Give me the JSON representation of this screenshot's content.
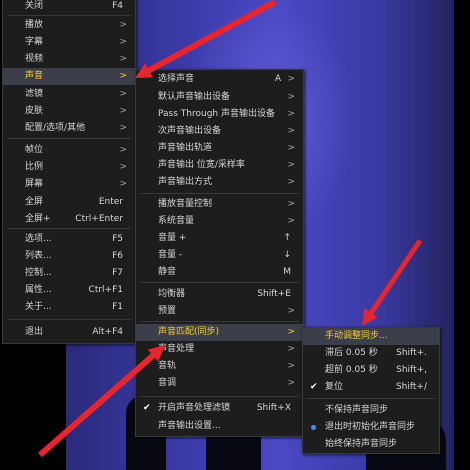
{
  "colors": {
    "highlight_text": "#ffcc33",
    "annotation_arrow": "#e8242c",
    "radio_dot": "#4a90e2"
  },
  "main_menu": {
    "items": [
      {
        "label": "关闭",
        "shortcut": "F4"
      },
      {
        "label": "播放",
        "arrow": ">"
      },
      {
        "label": "字幕",
        "arrow": ">"
      },
      {
        "label": "视频",
        "arrow": ">"
      },
      {
        "label": "声音",
        "arrow": ">"
      },
      {
        "label": "滤镜",
        "arrow": ">"
      },
      {
        "label": "皮肤",
        "arrow": ">"
      },
      {
        "label": "配置/选项/其他",
        "arrow": ">"
      },
      {
        "label": "帧位",
        "arrow": ">"
      },
      {
        "label": "比例",
        "arrow": ">"
      },
      {
        "label": "屏幕",
        "arrow": ">"
      },
      {
        "label": "全屏",
        "shortcut": "Enter"
      },
      {
        "label": "全屏+",
        "shortcut": "Ctrl+Enter"
      },
      {
        "label": "选项...",
        "shortcut": "F5"
      },
      {
        "label": "列表...",
        "shortcut": "F6"
      },
      {
        "label": "控制...",
        "shortcut": "F7"
      },
      {
        "label": "属性...",
        "shortcut": "Ctrl+F1"
      },
      {
        "label": "关于...",
        "shortcut": "F1"
      },
      {
        "label": "退出",
        "shortcut": "Alt+F4"
      }
    ]
  },
  "audio_menu": {
    "items": [
      {
        "label": "选择声音",
        "shortcut": "A",
        "arrow": ">"
      },
      {
        "label": "默认声音输出设备",
        "arrow": ">"
      },
      {
        "label": "Pass Through 声音输出设备",
        "arrow": ">"
      },
      {
        "label": "次声音输出设备",
        "arrow": ">"
      },
      {
        "label": "声音输出轨道",
        "arrow": ">"
      },
      {
        "label": "声音输出 位宽/采样率",
        "arrow": ">"
      },
      {
        "label": "声音输出方式",
        "arrow": ">"
      },
      {
        "label": "播放音量控制",
        "arrow": ">"
      },
      {
        "label": "系统音量",
        "arrow": ">"
      },
      {
        "label": "音量 +",
        "shortcut": "↑"
      },
      {
        "label": "音量 -",
        "shortcut": "↓"
      },
      {
        "label": "静音",
        "shortcut": "M"
      },
      {
        "label": "均衡器",
        "shortcut": "Shift+E"
      },
      {
        "label": "预置",
        "arrow": ">"
      },
      {
        "label": "声音匹配(同步)",
        "arrow": ">"
      },
      {
        "label": "声音处理",
        "arrow": ">"
      },
      {
        "label": "音轨",
        "arrow": ">"
      },
      {
        "label": "音调",
        "arrow": ">"
      },
      {
        "label": "开启声音处理滤镜",
        "shortcut": "Shift+X",
        "checked": true
      },
      {
        "label": "声音输出设置..."
      }
    ]
  },
  "sync_menu": {
    "items": [
      {
        "label": "手动调整同步..."
      },
      {
        "label": "滞后 0.05 秒",
        "shortcut": "Shift+."
      },
      {
        "label": "超前 0.05 秒",
        "shortcut": "Shift+,"
      },
      {
        "label": "复位",
        "shortcut": "Shift+/",
        "checked": true
      },
      {
        "label": "不保持声音同步"
      },
      {
        "label": "退出时初始化声音同步",
        "radio": true
      },
      {
        "label": "始终保持声音同步"
      }
    ]
  }
}
